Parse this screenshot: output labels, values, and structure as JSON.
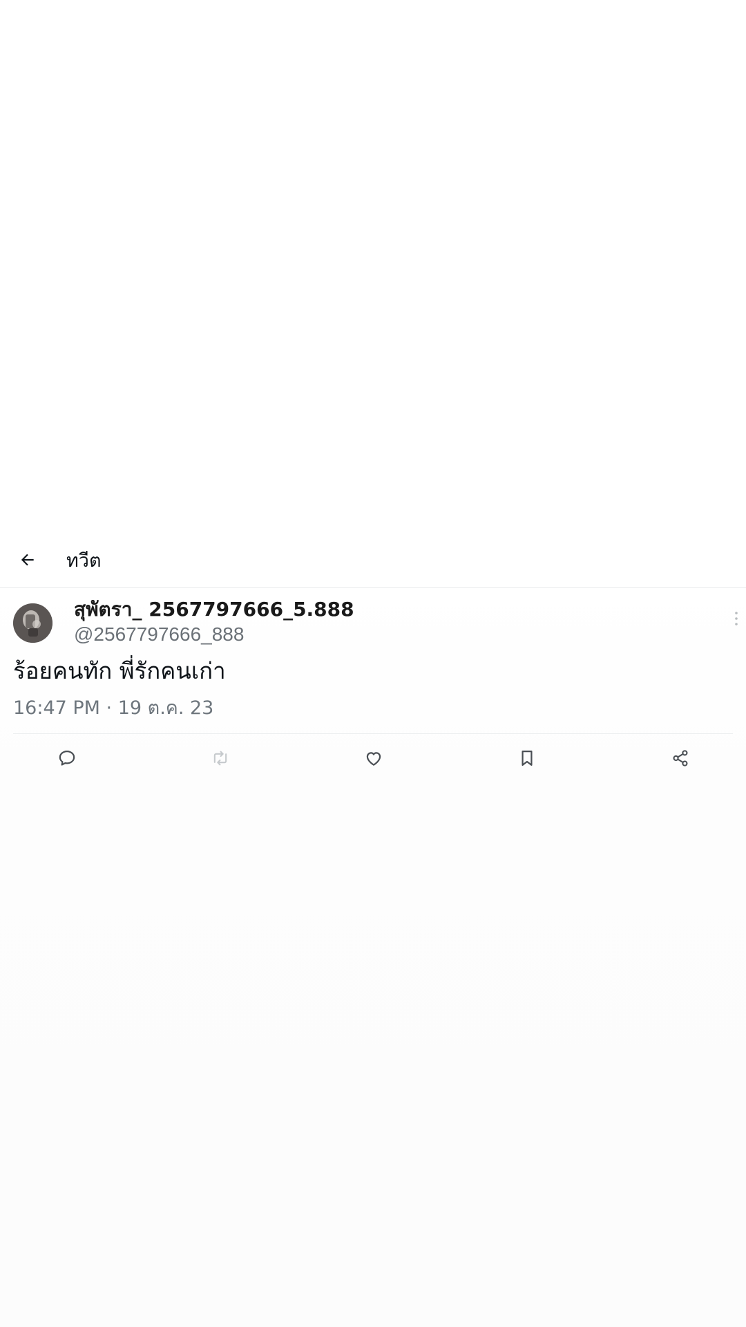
{
  "header": {
    "back_icon": "arrow-left-icon",
    "title": "ทวีต"
  },
  "tweet": {
    "display_name": "สุพัตรา_ 2567797666_5.888",
    "handle": "@2567797666_888",
    "text": "ร้อยคนทัก พี่รักคนเก่า",
    "meta": "16:47 PM · 19 ต.ค. 23"
  },
  "actions": [
    {
      "name": "reply",
      "icon": "comment-icon"
    },
    {
      "name": "retweet",
      "icon": "retweet-icon",
      "disabled": true
    },
    {
      "name": "like",
      "icon": "heart-icon"
    },
    {
      "name": "bookmark",
      "icon": "bookmark-icon"
    },
    {
      "name": "share",
      "icon": "share-icon"
    }
  ],
  "colors": {
    "text_primary": "#0f1419",
    "text_secondary": "#6e767d",
    "icon_active": "#4a4f54",
    "icon_disabled": "#c6cacd",
    "divider": "#e8eaec"
  }
}
